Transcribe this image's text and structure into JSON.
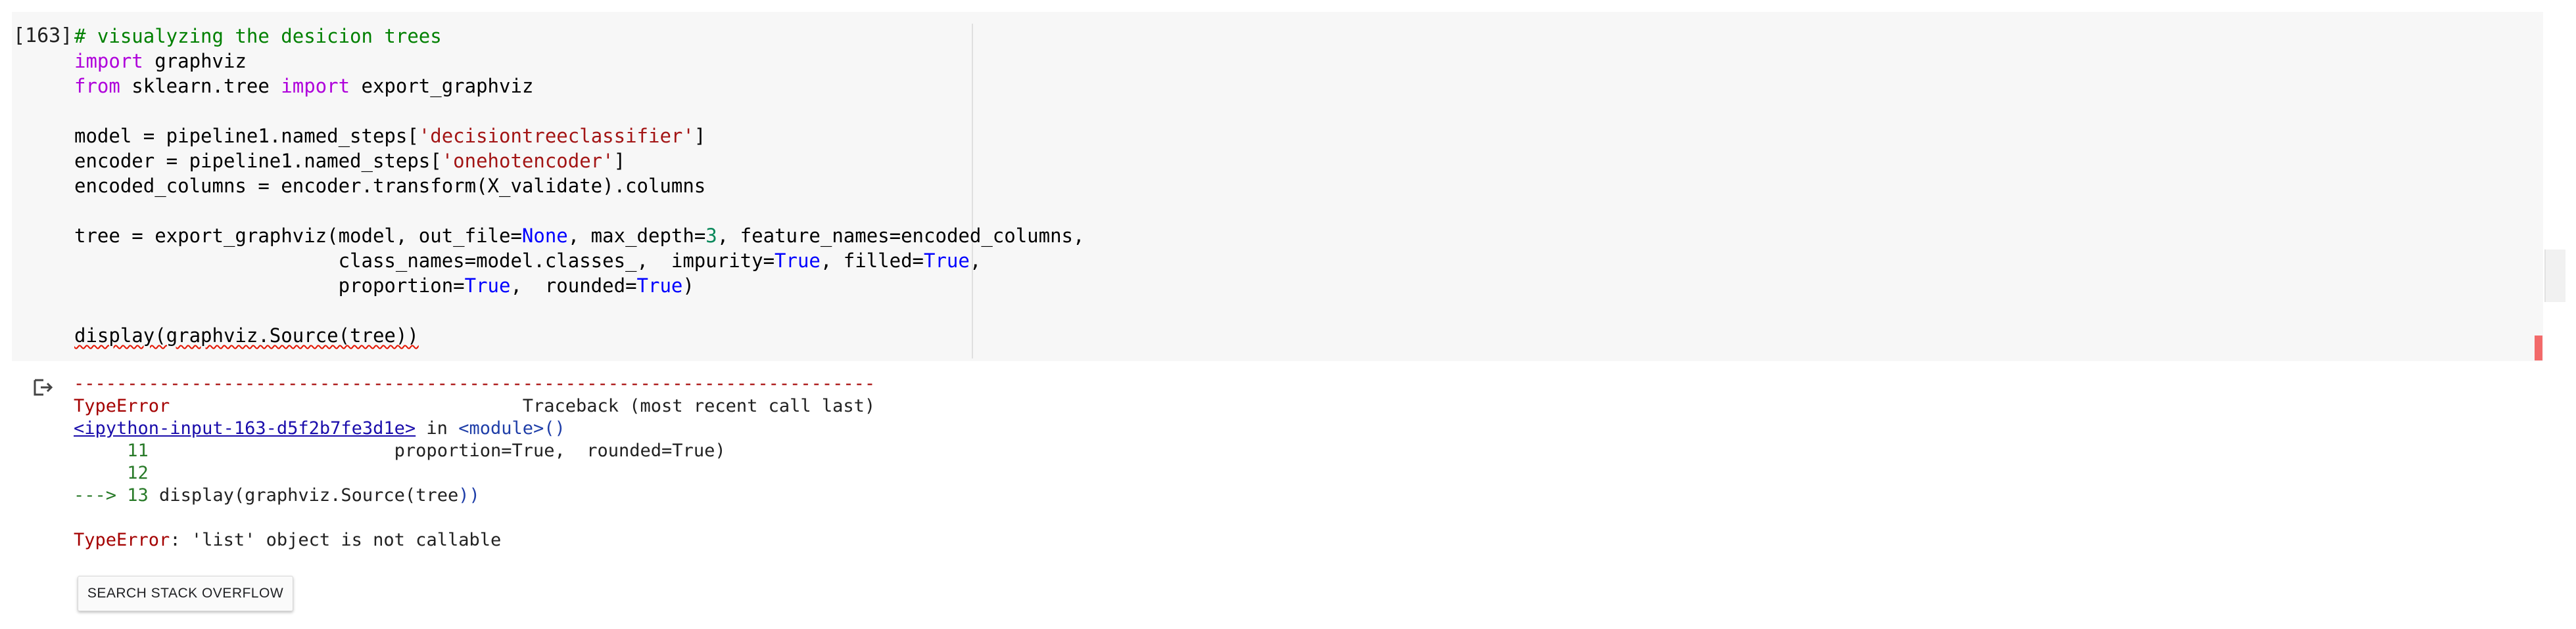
{
  "cell": {
    "execution_count": "[163]",
    "code": {
      "l1": "# visualyzing the desicion trees",
      "l2_kw": "import",
      "l2_rest": " graphviz",
      "l3_kw1": "from",
      "l3_mid": " sklearn.tree ",
      "l3_kw2": "import",
      "l3_rest": " export_graphviz",
      "l5_a": "model = pipeline1.named_steps[",
      "l5_str": "'decisiontreeclassifier'",
      "l5_b": "]",
      "l6_a": "encoder = pipeline1.named_steps[",
      "l6_str": "'onehotencoder'",
      "l6_b": "]",
      "l7": "encoded_columns = encoder.transform(X_validate).columns",
      "l9_a": "tree = export_graphviz(model, out_file=",
      "l9_none": "None",
      "l9_b": ", max_depth=",
      "l9_num": "3",
      "l9_c": ", feature_names=encoded_columns,",
      "l10_a": "                       class_names=model.classes_,  impurity=",
      "l10_true1": "True",
      "l10_b": ", filled=",
      "l10_true2": "True",
      "l10_c": ",",
      "l11_a": "                       proportion=",
      "l11_true1": "True",
      "l11_b": ",  rounded=",
      "l11_true2": "True",
      "l11_c": ")",
      "l13": "display(graphviz.Source(tree))"
    }
  },
  "output": {
    "icon": "output-cell-icon",
    "dashes": "---------------------------------------------------------------------------",
    "error_type": "TypeError",
    "traceback_header": "                                 Traceback (most recent call last)",
    "input_link": "<ipython-input-163-d5f2b7fe3d1e>",
    "in_text": " in ",
    "module_text": "<module>()",
    "line11_num": "     11",
    "line11_code": "                       proportion=True,  rounded=True)",
    "line12_num": "     12",
    "arrow": "---> 13",
    "line13_a": " display(graphviz.Source(",
    "line13_b": "tree",
    "line13_c": "))",
    "final_error_type": "TypeError",
    "final_error_msg": ": 'list' object is not callable"
  },
  "search_button": {
    "label": "SEARCH STACK OVERFLOW"
  },
  "colors": {
    "keyword": "#af00db",
    "comment": "#008000",
    "string": "#a31515",
    "number": "#09885a",
    "constant": "#0000ff",
    "error_red": "#a40000",
    "error_green": "#287a28",
    "link": "#1a0dab"
  }
}
